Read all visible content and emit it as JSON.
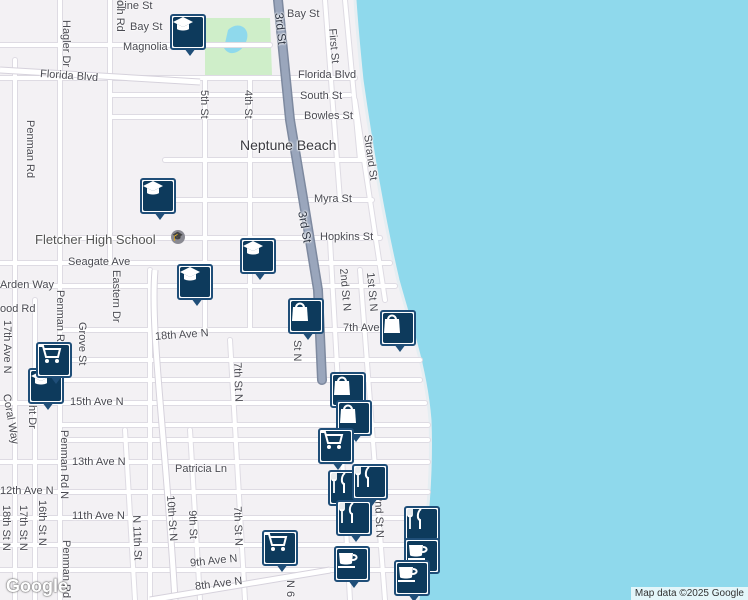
{
  "map": {
    "colors": {
      "land": "#f3f1f4",
      "water": "#8fd9ec",
      "park": "#cfeec9",
      "road": "#ffffff",
      "road_edge": "#dcd9e0",
      "highway": "#8f9cb3",
      "pin_border": "#1f4e78",
      "pin_fill": "#0d3a5c"
    },
    "place_label": "Neptune Beach",
    "school_label": "Fletcher High School",
    "streets": [
      {
        "id": "pine-st",
        "text": "Pine St"
      },
      {
        "id": "bay-st-w",
        "text": "Bay St"
      },
      {
        "id": "bay-st-e",
        "text": "Bay St"
      },
      {
        "id": "magnolia",
        "text": "Magnolia"
      },
      {
        "id": "florida-blvd-w",
        "text": "Florida Blvd"
      },
      {
        "id": "florida-blvd-e",
        "text": "Florida Blvd"
      },
      {
        "id": "south-st",
        "text": "South St"
      },
      {
        "id": "bowles-st",
        "text": "Bowles St"
      },
      {
        "id": "myra-st",
        "text": "Myra St"
      },
      {
        "id": "hopkins-st",
        "text": "Hopkins St"
      },
      {
        "id": "seagate-ave",
        "text": "Seagate Ave"
      },
      {
        "id": "arden-way",
        "text": "Arden Way"
      },
      {
        "id": "wood-rd",
        "text": "ood Rd"
      },
      {
        "id": "18th-ave-n",
        "text": "18th Ave N"
      },
      {
        "id": "7th-ave",
        "text": "7th Ave"
      },
      {
        "id": "15th-ave-n",
        "text": "15th Ave N"
      },
      {
        "id": "13th-ave-n",
        "text": "13th Ave N"
      },
      {
        "id": "patricia-ln",
        "text": "Patricia Ln"
      },
      {
        "id": "12th-ave-n",
        "text": "12th Ave N"
      },
      {
        "id": "11th-ave-n",
        "text": "11th Ave N"
      },
      {
        "id": "9th-ave-n",
        "text": "9th Ave N"
      },
      {
        "id": "8th-ave-n",
        "text": "8th Ave N"
      },
      {
        "id": "hagler-dr",
        "text": "Hagler Dr"
      },
      {
        "id": "penman-rd-top",
        "text": "Penman Rd"
      },
      {
        "id": "penman-rd-mid",
        "text": "Penman Rd"
      },
      {
        "id": "penman-rd-bot",
        "text": "Penman Rd"
      },
      {
        "id": "grove-st",
        "text": "Grove St"
      },
      {
        "id": "eastern-dr",
        "text": "Eastern Dr"
      },
      {
        "id": "5th-st",
        "text": "5th St"
      },
      {
        "id": "4th-st",
        "text": "4th St"
      },
      {
        "id": "3rd-st-top",
        "text": "3rd St"
      },
      {
        "id": "3rd-st-mid",
        "text": "3rd St"
      },
      {
        "id": "3rd-st-low",
        "text": "St N"
      },
      {
        "id": "first-st",
        "text": "First St"
      },
      {
        "id": "strand-st",
        "text": "Strand St"
      },
      {
        "id": "2nd-st-n",
        "text": "2nd St N"
      },
      {
        "id": "1st-st-n",
        "text": "1st St N"
      },
      {
        "id": "2nd-st-n-low",
        "text": "2nd St N"
      },
      {
        "id": "7th-st-n",
        "text": "7th St N"
      },
      {
        "id": "7th-st-n-low",
        "text": "7th St N"
      },
      {
        "id": "9th-st",
        "text": "9th St"
      },
      {
        "id": "10th-st-n",
        "text": "10th St N"
      },
      {
        "id": "n-11th-st",
        "text": "N 11th St"
      },
      {
        "id": "penman-rd-n",
        "text": "Penman Rd N"
      },
      {
        "id": "coral-way",
        "text": "Coral Way"
      },
      {
        "id": "16th-st-n",
        "text": "16th St N"
      },
      {
        "id": "17th-st-n",
        "text": "17th St N"
      },
      {
        "id": "18th-st-n",
        "text": "18th St N"
      },
      {
        "id": "17th-ave-n-w",
        "text": "17th Ave N"
      },
      {
        "id": "ht-dr",
        "text": "ht Dr"
      },
      {
        "id": "rd-fragment",
        "text": "olh Rd"
      },
      {
        "id": "n-6",
        "text": "N 6"
      }
    ],
    "pois": [
      {
        "icon": "school-icon"
      },
      {
        "icon": "school-icon"
      },
      {
        "icon": "school-icon"
      },
      {
        "icon": "school-icon"
      },
      {
        "icon": "school-icon"
      },
      {
        "icon": "shopping-bag-icon"
      },
      {
        "icon": "shopping-bag-icon"
      },
      {
        "icon": "shopping-bag-icon"
      },
      {
        "icon": "shopping-bag-icon"
      },
      {
        "icon": "shopping-cart-icon"
      },
      {
        "icon": "shopping-cart-icon"
      },
      {
        "icon": "shopping-cart-icon"
      },
      {
        "icon": "restaurant-icon"
      },
      {
        "icon": "restaurant-icon"
      },
      {
        "icon": "restaurant-icon"
      },
      {
        "icon": "restaurant-icon"
      },
      {
        "icon": "cafe-icon"
      },
      {
        "icon": "cafe-icon"
      },
      {
        "icon": "cafe-icon"
      }
    ],
    "logo": "Google",
    "attribution": "Map data ©2025 Google"
  }
}
